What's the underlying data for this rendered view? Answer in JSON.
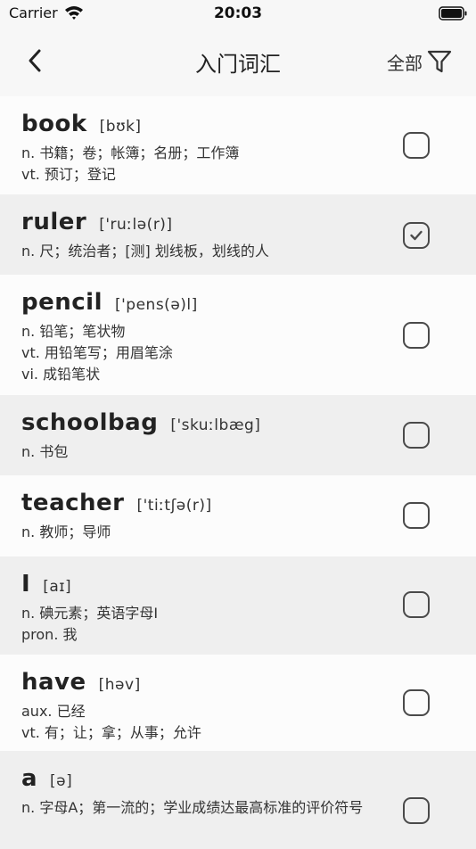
{
  "status": {
    "carrier": "Carrier",
    "time": "20:03"
  },
  "nav": {
    "title": "入门词汇",
    "filter_label": "全部"
  },
  "words": [
    {
      "word": "book",
      "phonetic": "[bʊk]",
      "defs": [
        "n. 书籍；卷；帐簿；名册；工作簿",
        "vt. 预订；登记"
      ],
      "checked": false
    },
    {
      "word": "ruler",
      "phonetic": "['ruːlə(r)]",
      "defs": [
        "n. 尺；统治者；[测] 划线板，划线的人"
      ],
      "checked": true
    },
    {
      "word": "pencil",
      "phonetic": "['pens(ə)l]",
      "defs": [
        "n. 铅笔；笔状物",
        "vt. 用铅笔写；用眉笔涂",
        "vi. 成铅笔状"
      ],
      "checked": false
    },
    {
      "word": "schoolbag",
      "phonetic": "['skuːlbæg]",
      "defs": [
        "n. 书包"
      ],
      "checked": false
    },
    {
      "word": "teacher",
      "phonetic": "['tiːtʃə(r)]",
      "defs": [
        "n. 教师；导师"
      ],
      "checked": false
    },
    {
      "word": "I",
      "phonetic": "[aɪ]",
      "defs": [
        "n. 碘元素；英语字母I",
        "pron. 我"
      ],
      "checked": false
    },
    {
      "word": "have",
      "phonetic": "[həv]",
      "defs": [
        "aux. 已经",
        "vt. 有；让；拿；从事；允许"
      ],
      "checked": false
    },
    {
      "word": "a",
      "phonetic": "[ə]",
      "defs": [
        "n. 字母A；第一流的；学业成绩达最高标准的评价符号"
      ],
      "checked": false
    }
  ]
}
